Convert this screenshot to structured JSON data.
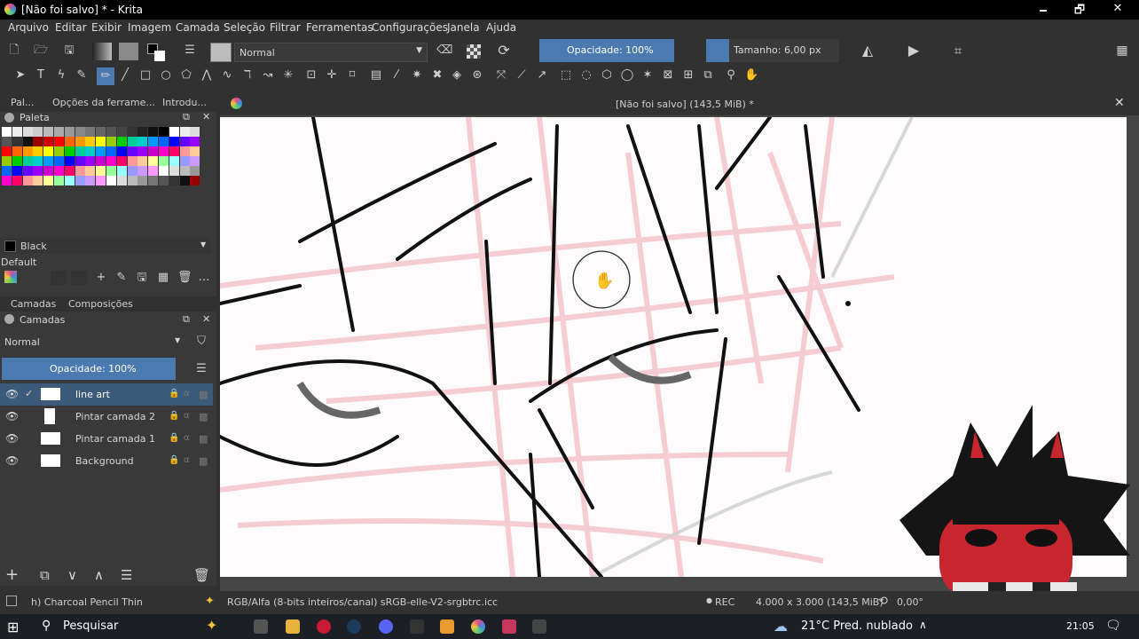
{
  "window": {
    "title": "[Não foi salvo] * - Krita",
    "title_prefix": "[Não foi salvo]",
    "title_size": "(143,5 MiB)",
    "title_suffix": "* - Krita",
    "minimize": "🗕",
    "maximize": "🗗",
    "close": "✕"
  },
  "menu": [
    "Arquivo",
    "Editar",
    "Exibir",
    "Imagem",
    "Camada",
    "Seleção",
    "Filtrar",
    "Ferramentas",
    "Configurações",
    "Janela",
    "Ajuda"
  ],
  "toolbar": {
    "blend_mode": "Normal",
    "opacity": "Opacidade: 100%",
    "size": "Tamanho: 6,00 px"
  },
  "left_tabs": [
    "Pal...",
    "Opções da ferrame...",
    "Introdu..."
  ],
  "palette": {
    "title": "Paleta",
    "current_color": "Black",
    "set_name": "Default"
  },
  "layers_tabs": [
    "Camadas",
    "Composições"
  ],
  "layers": {
    "title": "Camadas",
    "blend_mode": "Normal",
    "opacity": "Opacidade:  100%",
    "items": [
      {
        "name": "line art",
        "selected": true
      },
      {
        "name": "Pintar camada 2",
        "selected": false
      },
      {
        "name": "Pintar camada 1",
        "selected": false
      },
      {
        "name": "Background",
        "selected": false
      }
    ]
  },
  "document": {
    "tab_title": "[Não foi salvo]  (143,5 MiB) *"
  },
  "status": {
    "brush": "h) Charcoal Pencil Thin",
    "color_space": "RGB/Alfa (8-bits inteiros/canal)  sRGB-elle-V2-srgbtrc.icc",
    "rec": "REC",
    "dimensions": "4.000 x 3.000 (143,5 MiB)",
    "rotation": "0,00°"
  },
  "taskbar": {
    "search": "Pesquisar",
    "weather": "21°C  Pred. nublado",
    "time": "21:05"
  },
  "colors": {
    "accent": "#3c5a79",
    "opacity_bar": "#4b7ab0",
    "bg": "#313131",
    "panel": "#393939"
  }
}
